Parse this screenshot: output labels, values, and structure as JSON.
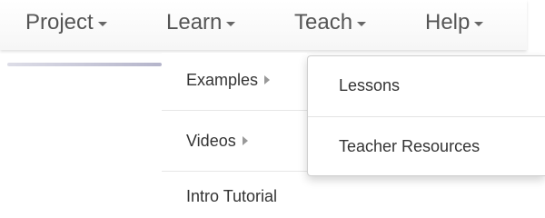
{
  "menubar": {
    "items": [
      {
        "label": "Project"
      },
      {
        "label": "Learn"
      },
      {
        "label": "Teach"
      },
      {
        "label": "Help"
      }
    ]
  },
  "learn_menu": {
    "items": [
      {
        "label": "Examples",
        "has_submenu": true
      },
      {
        "label": "Videos",
        "has_submenu": true
      },
      {
        "label": "Intro Tutorial",
        "has_submenu": false
      }
    ]
  },
  "examples_submenu": {
    "items": [
      {
        "label": "Lessons"
      },
      {
        "label": "Teacher Resources"
      }
    ]
  },
  "icons": {
    "dropdown_caret": "chevron-down-icon",
    "submenu_caret": "chevron-right-icon"
  }
}
